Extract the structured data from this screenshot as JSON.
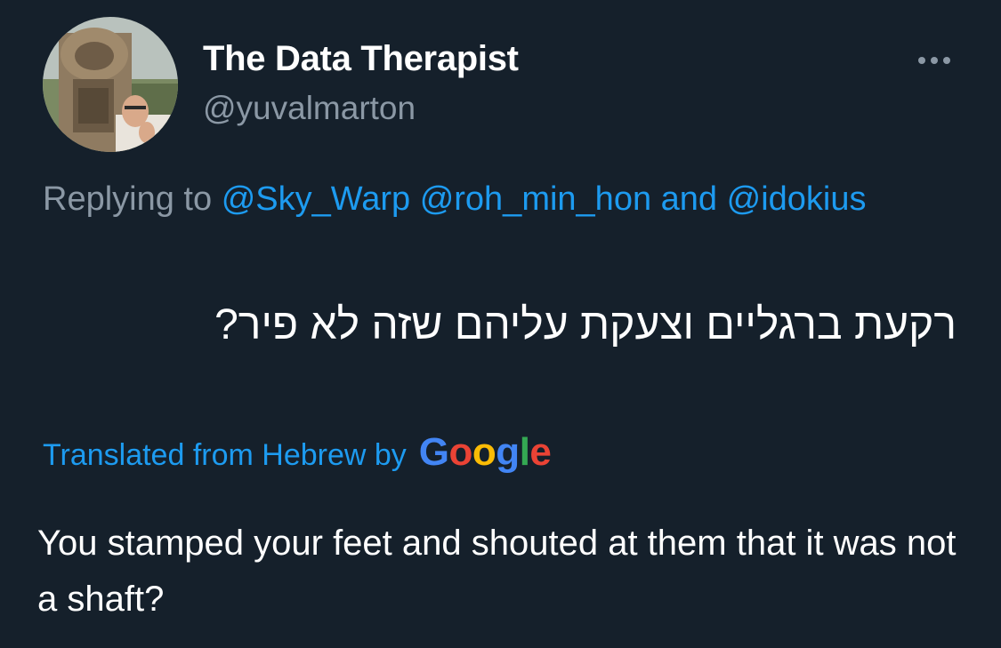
{
  "author": {
    "display_name": "The Data Therapist",
    "handle": "@yuvalmarton",
    "avatar_icon": "profile-photo-avatar"
  },
  "menu": {
    "more_icon": "more-horizontal-icon"
  },
  "reply": {
    "prefix": "Replying to",
    "mentions": [
      "@Sky_Warp",
      "@roh_min_hon",
      "@idokius"
    ],
    "conjunction": "and"
  },
  "tweet": {
    "original_text": "רקעת ברגליים וצעקת עליהם שזה לא פיר?",
    "translation_label": "Translated from Hebrew by",
    "translation_provider": "Google",
    "translated_text": "You stamped your feet and shouted at them that it was not a shaft?"
  },
  "colors": {
    "background": "#15202b",
    "accent": "#1d9bf0",
    "secondary_text": "#8b98a5",
    "primary_text": "#ffffff",
    "google": [
      "#4285F4",
      "#EA4335",
      "#FBBC05",
      "#4285F4",
      "#34A853",
      "#EA4335"
    ]
  }
}
